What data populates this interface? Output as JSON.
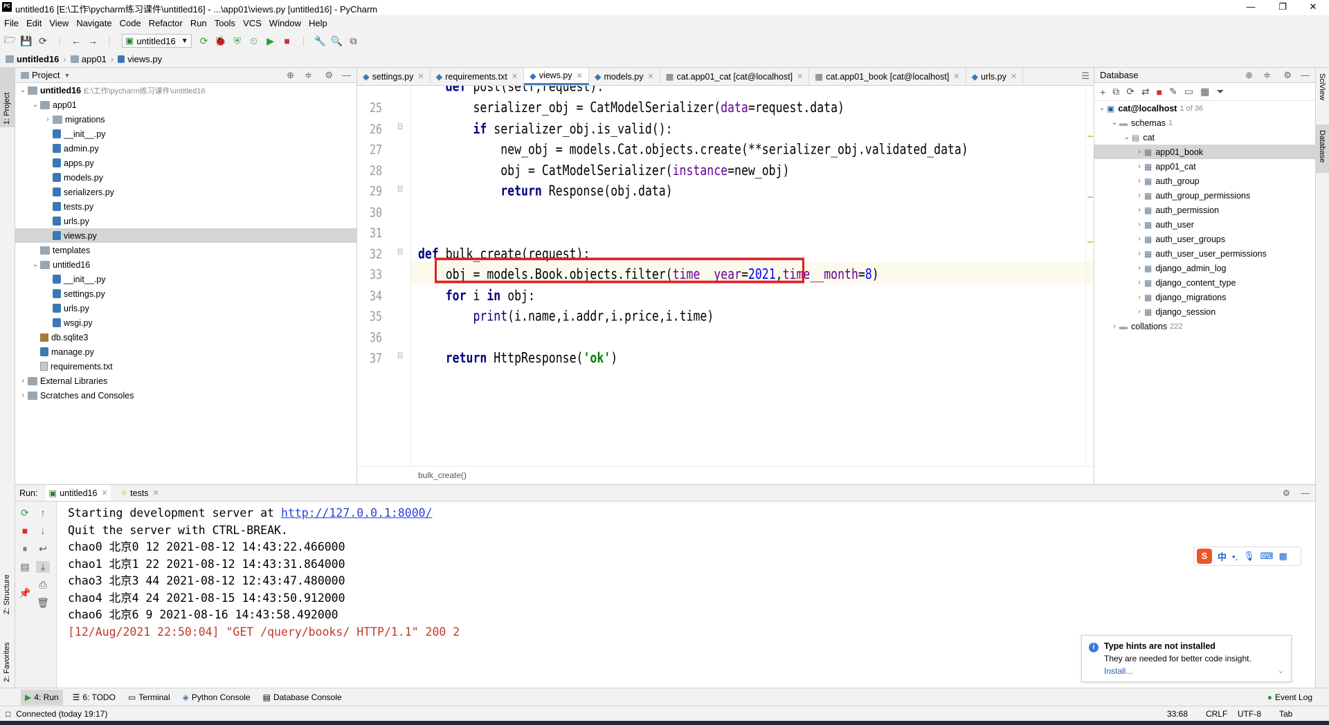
{
  "window": {
    "title": "untitled16 [E:\\工作\\pycharm练习课件\\untitled16] - ...\\app01\\views.py [untitled16] - PyCharm",
    "logo": "PC"
  },
  "menu": [
    "File",
    "Edit",
    "View",
    "Navigate",
    "Code",
    "Refactor",
    "Run",
    "Tools",
    "VCS",
    "Window",
    "Help"
  ],
  "toolbar": {
    "run_config": "untitled16"
  },
  "breadcrumb": [
    "untitled16",
    "app01",
    "views.py"
  ],
  "left_strip": {
    "project": "1: Project",
    "structure": "Z: Structure",
    "favorites": "2: Favorites"
  },
  "project": {
    "title": "Project",
    "tree": [
      {
        "label": "untitled16",
        "hint": "E:\\工作\\pycharm练习课件\\untitled16",
        "type": "folder",
        "depth": 0,
        "arrow": "v",
        "bold": true
      },
      {
        "label": "app01",
        "type": "folder",
        "depth": 1,
        "arrow": "v"
      },
      {
        "label": "migrations",
        "type": "folder",
        "depth": 2,
        "arrow": ">"
      },
      {
        "label": "__init__.py",
        "type": "py",
        "depth": 2
      },
      {
        "label": "admin.py",
        "type": "py",
        "depth": 2
      },
      {
        "label": "apps.py",
        "type": "py",
        "depth": 2
      },
      {
        "label": "models.py",
        "type": "py",
        "depth": 2
      },
      {
        "label": "serializers.py",
        "type": "py",
        "depth": 2
      },
      {
        "label": "tests.py",
        "type": "py",
        "depth": 2
      },
      {
        "label": "urls.py",
        "type": "py",
        "depth": 2
      },
      {
        "label": "views.py",
        "type": "py",
        "depth": 2,
        "selected": true
      },
      {
        "label": "templates",
        "type": "folder",
        "depth": 1
      },
      {
        "label": "untitled16",
        "type": "folder",
        "depth": 1,
        "arrow": "v"
      },
      {
        "label": "__init__.py",
        "type": "py",
        "depth": 2
      },
      {
        "label": "settings.py",
        "type": "py",
        "depth": 2
      },
      {
        "label": "urls.py",
        "type": "py",
        "depth": 2
      },
      {
        "label": "wsgi.py",
        "type": "py",
        "depth": 2
      },
      {
        "label": "db.sqlite3",
        "type": "db",
        "depth": 1
      },
      {
        "label": "manage.py",
        "type": "py",
        "depth": 1
      },
      {
        "label": "requirements.txt",
        "type": "txt",
        "depth": 1
      },
      {
        "label": "External Libraries",
        "type": "lib",
        "depth": 0,
        "arrow": ">"
      },
      {
        "label": "Scratches and Consoles",
        "type": "lib",
        "depth": 0,
        "arrow": ">"
      }
    ]
  },
  "tabs": [
    {
      "label": "settings.py"
    },
    {
      "label": "requirements.txt"
    },
    {
      "label": "views.py",
      "active": true
    },
    {
      "label": "models.py"
    },
    {
      "label": "cat.app01_cat [cat@localhost]"
    },
    {
      "label": "cat.app01_book [cat@localhost]"
    },
    {
      "label": "urls.py"
    }
  ],
  "editor": {
    "top_partial": "    def post(self,request):",
    "lines": [
      {
        "n": "25",
        "code": "        serializer_obj = CatModelSerializer(data=request.data)"
      },
      {
        "n": "26",
        "code": "        if serializer_obj.is_valid():"
      },
      {
        "n": "27",
        "code": "            new_obj = models.Cat.objects.create(**serializer_obj.validated_data)"
      },
      {
        "n": "28",
        "code": "            obj = CatModelSerializer(instance=new_obj)"
      },
      {
        "n": "29",
        "code": "            return Response(obj.data)"
      },
      {
        "n": "30",
        "code": ""
      },
      {
        "n": "31",
        "code": ""
      },
      {
        "n": "32",
        "code": "def bulk_create(request):"
      },
      {
        "n": "33",
        "code": "    obj = models.Book.objects.filter(time__year=2021,time__month=8)"
      },
      {
        "n": "34",
        "code": "    for i in obj:"
      },
      {
        "n": "35",
        "code": "        print(i.name,i.addr,i.price,i.time)"
      },
      {
        "n": "36",
        "code": ""
      },
      {
        "n": "37",
        "code": "    return HttpResponse('ok')"
      }
    ],
    "status_crumb": "bulk_create()"
  },
  "database": {
    "title": "Database",
    "root": {
      "label": "cat@localhost",
      "hint": "1 of 36"
    },
    "schemas": {
      "label": "schemas",
      "hint": "1"
    },
    "schema": "cat",
    "tables": [
      "app01_book",
      "app01_cat",
      "auth_group",
      "auth_group_permissions",
      "auth_permission",
      "auth_user",
      "auth_user_groups",
      "auth_user_user_permissions",
      "django_admin_log",
      "django_content_type",
      "django_migrations",
      "django_session"
    ],
    "collations": {
      "label": "collations",
      "hint": "222"
    }
  },
  "right_strip": {
    "sciview": "SciView",
    "database": "Database"
  },
  "run": {
    "label": "Run:",
    "tabs": [
      "untitled16",
      "tests"
    ],
    "console": [
      {
        "text": "Starting development server at ",
        "link": "http://127.0.0.1:8000/"
      },
      {
        "text": "Quit the server with CTRL-BREAK."
      },
      {
        "text": "chao0 北京0 12 2021-08-12 14:43:22.466000"
      },
      {
        "text": "chao1 北京1 22 2021-08-12 14:43:31.864000"
      },
      {
        "text": "chao3 北京3 44 2021-08-12 12:43:47.480000"
      },
      {
        "text": "chao4 北京4 24 2021-08-15 14:43:50.912000"
      },
      {
        "text": "chao6 北京6 9 2021-08-16 14:43:58.492000"
      },
      {
        "text": "[12/Aug/2021 22:50:04] \"GET /query/books/ HTTP/1.1\" 200 2",
        "color": "#c0392b"
      }
    ]
  },
  "ime": {
    "logo": "S",
    "mode": "中"
  },
  "notification": {
    "title": "Type hints are not installed",
    "body": "They are needed for better code insight.",
    "action": "Install..."
  },
  "bottom_tools": [
    "4: Run",
    "6: TODO",
    "Terminal",
    "Python Console",
    "Database Console"
  ],
  "event_log": "Event Log",
  "status": {
    "left": "Connected (today 19:17)",
    "position": "33:68",
    "line_sep": "CRLF",
    "encoding": "UTF-8",
    "indent": "Tab"
  }
}
